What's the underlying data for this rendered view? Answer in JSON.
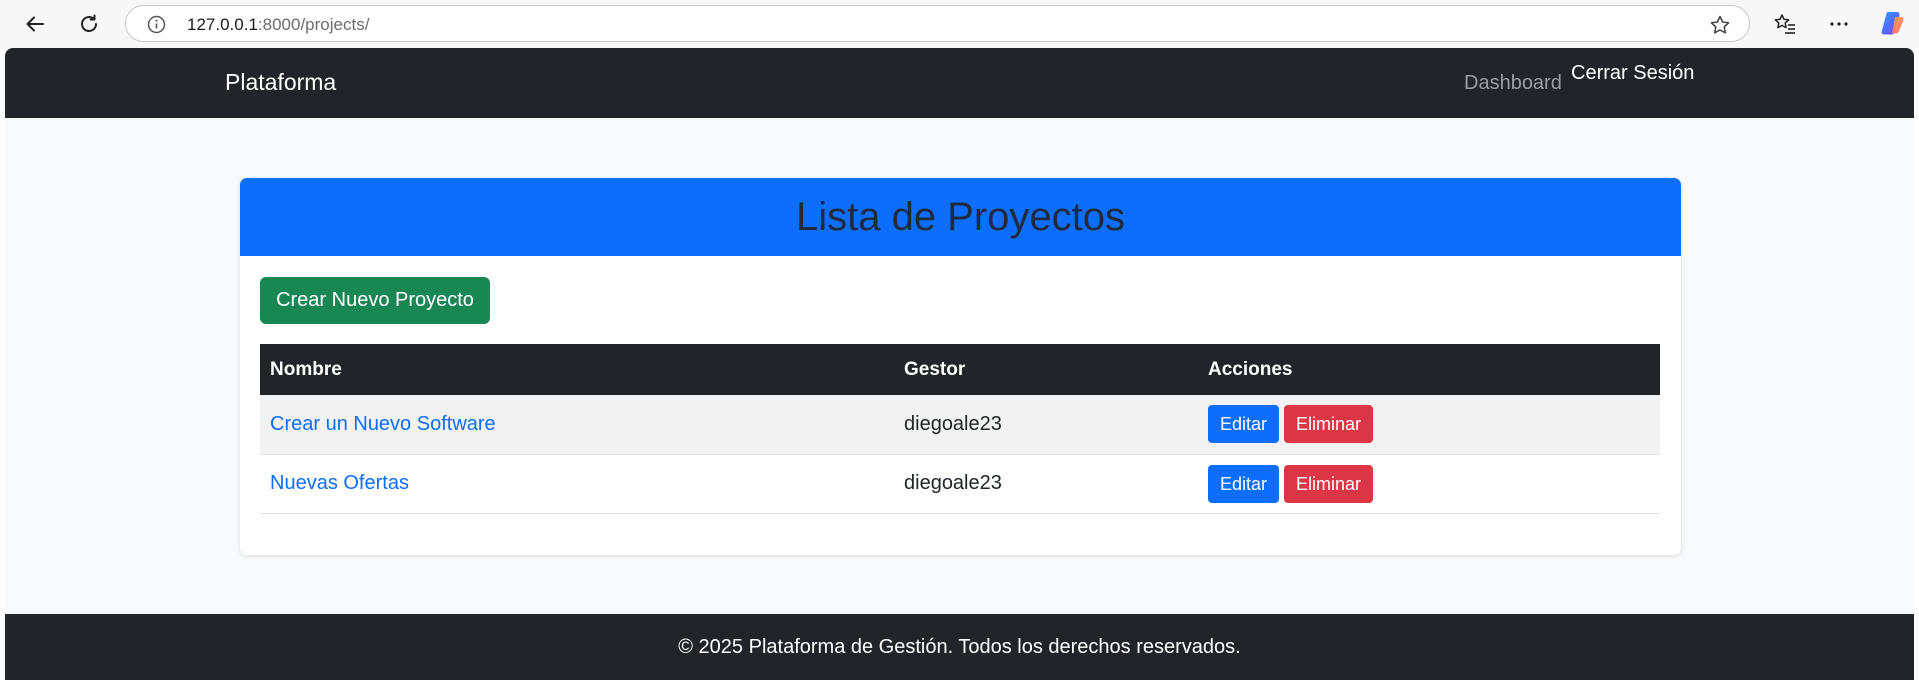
{
  "browser": {
    "url_host": "127.0.0.1",
    "url_rest": ":8000/projects/"
  },
  "navbar": {
    "brand": "Plataforma",
    "links": [
      {
        "label": "Dashboard"
      },
      {
        "label": "Cerrar Sesión"
      }
    ]
  },
  "card": {
    "title": "Lista de Proyectos",
    "create_button": "Crear Nuevo Proyecto",
    "table": {
      "headers": [
        "Nombre",
        "Gestor",
        "Acciones"
      ],
      "rows": [
        {
          "name": "Crear un Nuevo Software",
          "manager": "diegoale23",
          "edit": "Editar",
          "delete": "Eliminar"
        },
        {
          "name": "Nuevas Ofertas",
          "manager": "diegoale23",
          "edit": "Editar",
          "delete": "Eliminar"
        }
      ]
    }
  },
  "footer": {
    "text": "© 2025 Plataforma de Gestión. Todos los derechos reservados."
  },
  "colors": {
    "navbar": "#212529",
    "primary": "#0d6efd",
    "success": "#198754",
    "danger": "#dc3545",
    "background": "#f8f9fa"
  },
  "icons": [
    "back-arrow-icon",
    "reload-icon",
    "info-icon",
    "star-icon",
    "favorites-icon",
    "more-icon",
    "copilot-icon"
  ]
}
